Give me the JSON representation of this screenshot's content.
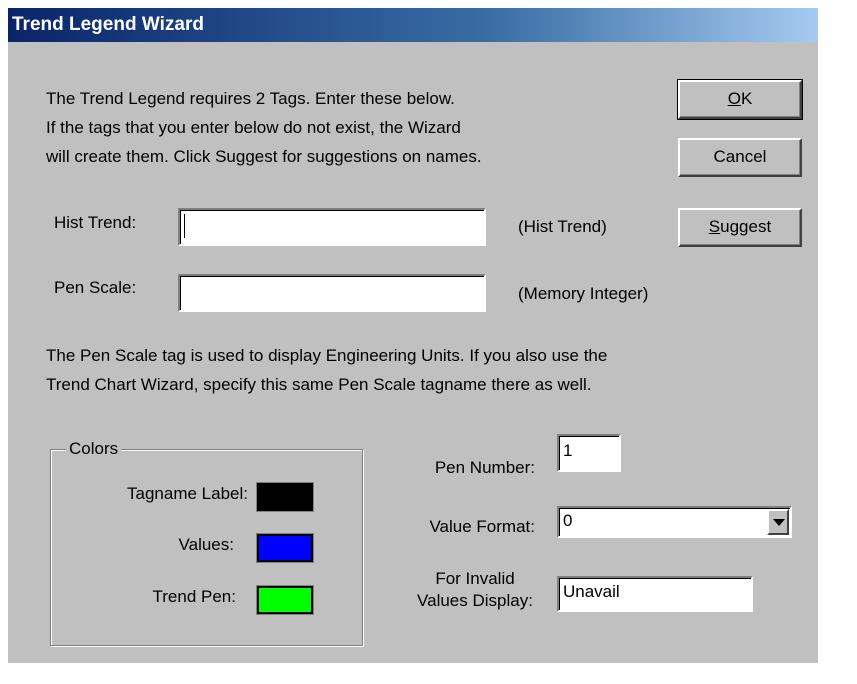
{
  "window": {
    "title": "Trend Legend Wizard"
  },
  "intro": {
    "line1": "The Trend Legend requires 2 Tags.  Enter these below.",
    "line2": "If the tags that you enter below do not exist, the Wizard",
    "line3": "will create them.  Click Suggest for suggestions on names."
  },
  "buttons": {
    "ok": "OK",
    "cancel": "Cancel",
    "suggest": "Suggest"
  },
  "hist_trend": {
    "label": "Hist Trend:",
    "value": "",
    "type": "(Hist Trend)"
  },
  "pen_scale": {
    "label": "Pen Scale:",
    "value": "",
    "type": "(Memory Integer)"
  },
  "note": {
    "line1": "The Pen Scale tag is used to display Engineering Units.  If you also use the",
    "line2": "Trend Chart Wizard, specify this same Pen Scale tagname there as well."
  },
  "colors": {
    "title": "Colors",
    "tagname_label": {
      "label": "Tagname Label:",
      "color": "#000000"
    },
    "values": {
      "label": "Values:",
      "color": "#0000ff"
    },
    "trend_pen": {
      "label": "Trend Pen:",
      "color": "#00ff00"
    }
  },
  "pen_number": {
    "label": "Pen Number:",
    "value": "1"
  },
  "value_format": {
    "label": "Value Format:",
    "value": "0"
  },
  "invalid_display": {
    "label_line1": "For Invalid",
    "label_line2": "Values Display:",
    "value": "Unavail"
  }
}
